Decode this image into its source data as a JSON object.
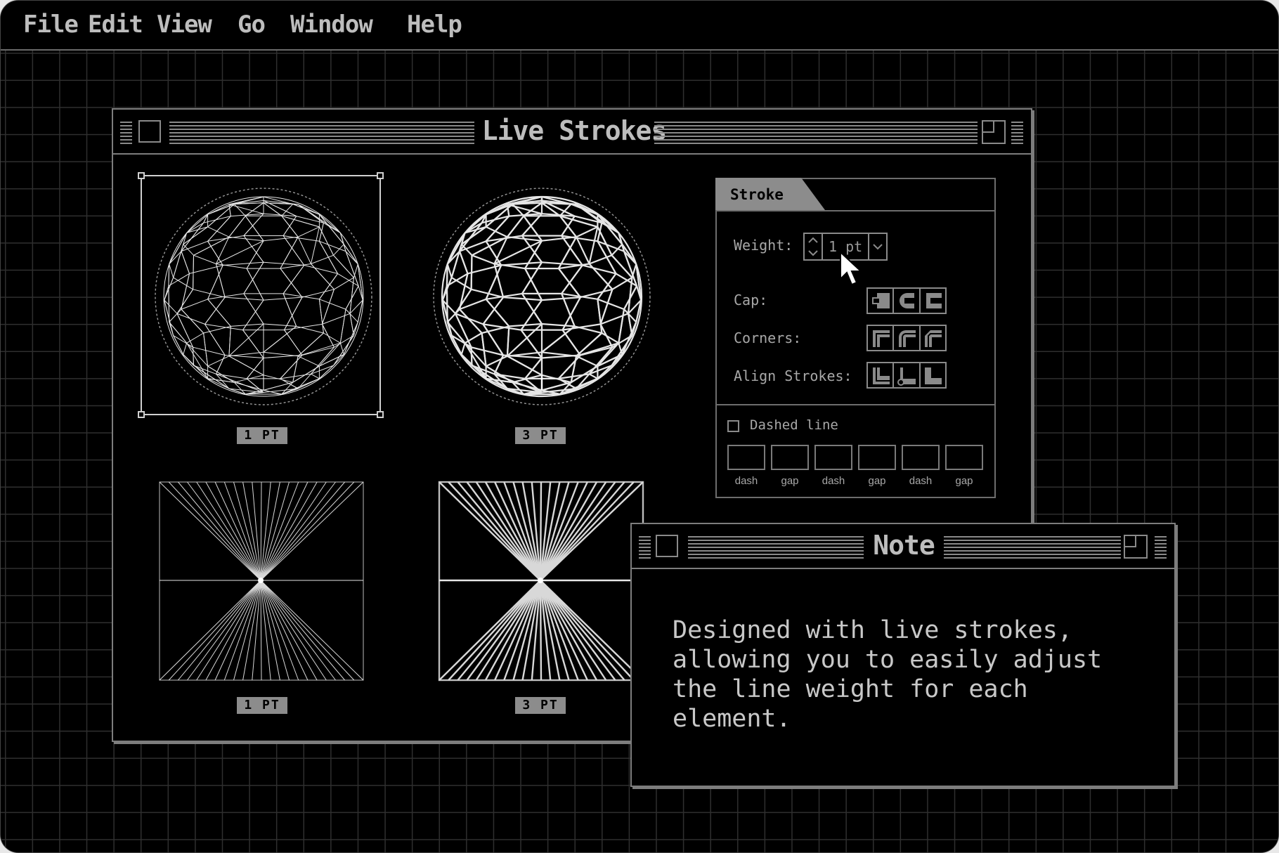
{
  "menubar": {
    "items": [
      "File",
      "Edit",
      "View",
      "Go",
      "Window",
      "Help"
    ]
  },
  "main_window": {
    "title": "Live Strokes",
    "samples": [
      {
        "label": "1 PT"
      },
      {
        "label": "3 PT"
      },
      {
        "label": "1 PT"
      },
      {
        "label": "3 PT"
      }
    ]
  },
  "stroke_panel": {
    "tab": "Stroke",
    "weight_label": "Weight:",
    "weight_value": "1 pt",
    "cap_label": "Cap:",
    "corners_label": "Corners:",
    "align_label": "Align Strokes:",
    "dashed_label": "Dashed line",
    "dashed_checked": false,
    "dash_fields": [
      "dash",
      "gap",
      "dash",
      "gap",
      "dash",
      "gap"
    ]
  },
  "note_window": {
    "title": "Note",
    "body": "Designed with live strokes,\nallowing you to easily adjust\nthe line weight for each\nelement."
  },
  "colors": {
    "background": "#000000",
    "chrome": "#7d7d7d",
    "text": "#bdbdbd",
    "highlight": "#ffffff"
  }
}
